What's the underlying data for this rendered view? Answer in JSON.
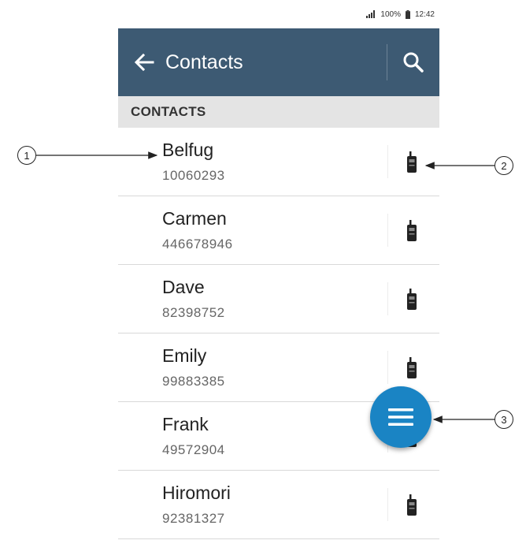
{
  "status_bar": {
    "battery": "100%",
    "time": "12:42"
  },
  "app_bar": {
    "title": "Contacts"
  },
  "section": {
    "header": "CONTACTS"
  },
  "contacts": [
    {
      "name": "Belfug",
      "number": "10060293"
    },
    {
      "name": "Carmen",
      "number": "446678946"
    },
    {
      "name": "Dave",
      "number": "82398752"
    },
    {
      "name": "Emily",
      "number": "99883385"
    },
    {
      "name": "Frank",
      "number": "49572904"
    },
    {
      "name": "Hiromori",
      "number": "92381327"
    }
  ],
  "callouts": [
    "1",
    "2",
    "3"
  ],
  "icons": {
    "back": "arrow-left-icon",
    "search": "search-icon",
    "contact_type": "radio-icon",
    "fab": "menu-icon"
  },
  "colors": {
    "app_bar": "#3d5a73",
    "fab": "#1a84c4",
    "section_header": "#e4e4e4"
  }
}
